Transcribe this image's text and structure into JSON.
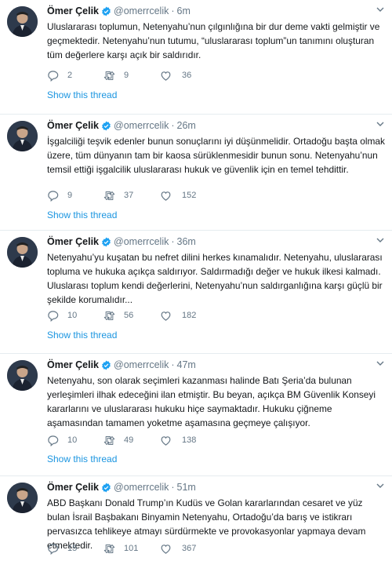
{
  "tweets": [
    {
      "name": "Ömer Çelik",
      "handle": "@omerrcelik",
      "dot": "·",
      "time": "6m",
      "text": "Uluslararası toplumun, Netenyahu’nun çılgınlığına bir dur deme vakti gelmiştir ve geçmektedir. Netenyahu’nun tutumu, “uluslararası toplum”un tanımını oluşturan tüm değerlere karşı açık bir saldırıdır.",
      "replies": "2",
      "retweets": "9",
      "likes": "36",
      "thread_link": "Show this thread"
    },
    {
      "name": "Ömer Çelik",
      "handle": "@omerrcelik",
      "dot": "·",
      "time": "26m",
      "text": "İşgalciliği teşvik edenler bunun sonuçlarını iyi düşünmelidir. Ortadoğu başta olmak üzere, tüm dünyanın tam bir kaosa sürüklenmesidir bunun sonu. Netenyahu’nun temsil ettiği işgalcilik uluslararası hukuk ve güvenlik için en temel tehdittir.",
      "replies": "9",
      "retweets": "37",
      "likes": "152",
      "thread_link": "Show this thread"
    },
    {
      "name": "Ömer Çelik",
      "handle": "@omerrcelik",
      "dot": "·",
      "time": "36m",
      "text": "Netenyahu’yu kuşatan bu nefret dilini herkes  kınamalıdır. Netenyahu, uluslararası topluma ve hukuka açıkça saldırıyor.  Saldırmadığı değer ve hukuk ilkesi kalmadı. Uluslarası toplum kendi değerlerini, Netenyahu’nun saldırganlığına karşı güçlü bir şekilde korumalıdır...",
      "replies": "10",
      "retweets": "56",
      "likes": "182",
      "thread_link": "Show this thread"
    },
    {
      "name": "Ömer Çelik",
      "handle": "@omerrcelik",
      "dot": "·",
      "time": "47m",
      "text": "Netenyahu, son olarak seçimleri kazanması halinde Batı Şeria’da bulunan yerleşimleri ilhak edeceğini ilan etmiştir. Bu beyan, açıkça BM Güvenlik Konseyi kararlarını ve uluslararası hukuku hiçe saymaktadır. Hukuku çiğneme aşamasından tamamen yoketme aşamasına geçmeye çalışıyor.",
      "replies": "10",
      "retweets": "49",
      "likes": "138",
      "thread_link": "Show this thread"
    },
    {
      "name": "Ömer Çelik",
      "handle": "@omerrcelik",
      "dot": "·",
      "time": "51m",
      "text": "ABD Başkanı Donald Trump’ın Kudüs ve Golan kararlarından cesaret ve yüz bulan İsrail Başbakanı Binyamin Netenyahu, Ortadoğu’da barış ve istikrarı pervasızca tehlikeye atmayı sürdürmekte ve provokasyonlar yapmaya devam etmektedir.",
      "replies": "15",
      "retweets": "101",
      "likes": "367"
    }
  ],
  "icons": {
    "avatar": "profile-photo",
    "verified": "verified-badge-icon",
    "caret": "chevron-down-icon",
    "reply": "reply-icon",
    "retweet": "retweet-icon",
    "like": "heart-icon"
  },
  "colors": {
    "text": "#14171a",
    "muted": "#657786",
    "link": "#1b95e0",
    "verified": "#1da1f2",
    "divider": "#e6ecf0"
  }
}
